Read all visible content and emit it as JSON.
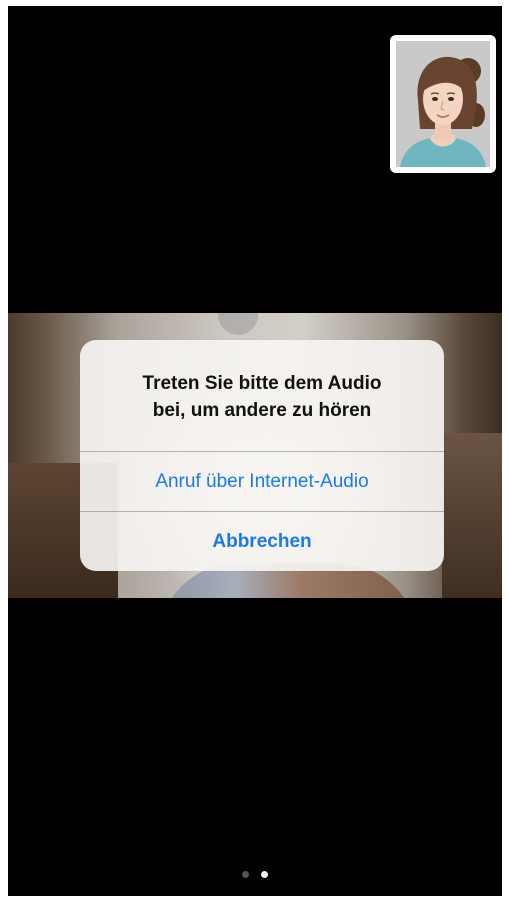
{
  "alert": {
    "title": "Treten Sie bitte dem Audio\nbei, um andere zu hören",
    "buttons": {
      "internet_audio": "Anruf über Internet-Audio",
      "cancel": "Abbrechen"
    },
    "accent_color": "#1a7ae8"
  },
  "self_view": {
    "icon": "avatar-portrait-icon"
  },
  "page_indicator": {
    "total_pages": 2,
    "current_page": 2
  }
}
